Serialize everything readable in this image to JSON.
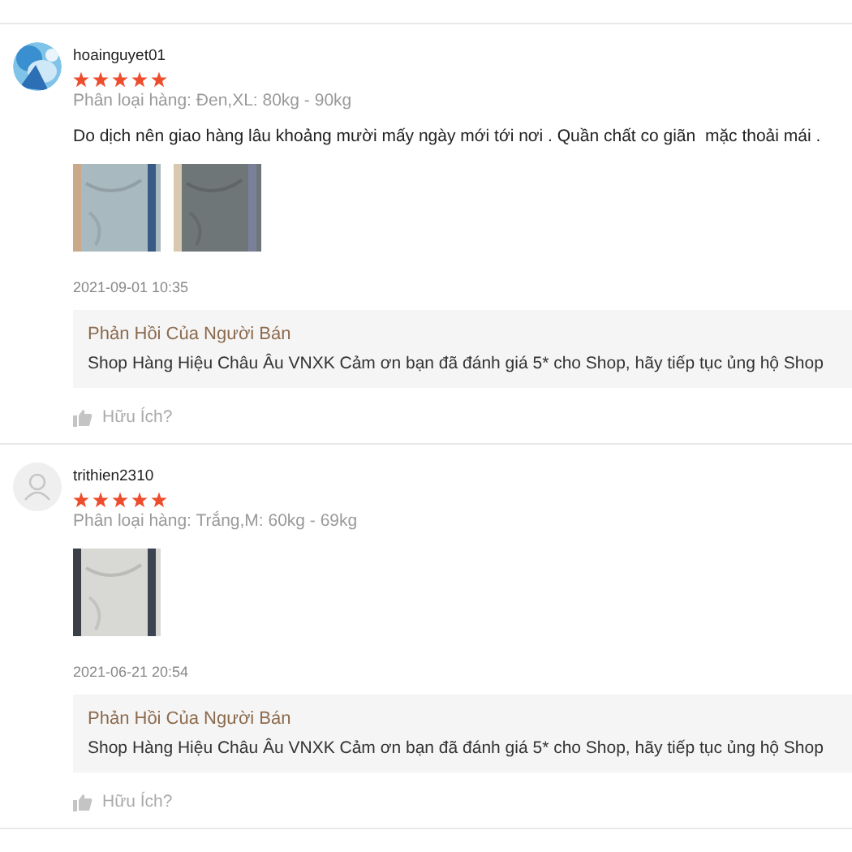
{
  "reviews": [
    {
      "username": "hoainguyet01",
      "avatar": {
        "kind": "picture"
      },
      "stars": 5,
      "variant": "Phân loại hàng: Đen,XL: 80kg - 90kg",
      "comment": "Do dịch nên giao hàng lâu khoảng mười mấy ngày mới tới nơi . Quần chất co giãn  mặc thoải mái .",
      "photos": [
        {
          "kind": "picture"
        },
        {
          "kind": "picture"
        }
      ],
      "date": "2021-09-01 10:35",
      "reply": {
        "title": "Phản Hồi Của Người Bán",
        "text": "Shop Hàng Hiệu Châu Âu VNXK Cảm ơn bạn đã đánh giá 5* cho Shop, hãy tiếp tục ủng hộ Shop"
      },
      "helpful": "Hữu Ích?"
    },
    {
      "username": "trithien2310",
      "avatar": {
        "kind": "default"
      },
      "stars": 5,
      "variant": "Phân loại hàng: Trắng,M: 60kg - 69kg",
      "photos": [
        {
          "kind": "picture"
        }
      ],
      "date": "2021-06-21 20:54",
      "reply": {
        "title": "Phản Hồi Của Người Bán",
        "text": "Shop Hàng Hiệu Châu Âu VNXK Cảm ơn bạn đã đánh giá 5* cho Shop, hãy tiếp tục ủng hộ Shop"
      },
      "helpful": "Hữu Ích?"
    }
  ]
}
